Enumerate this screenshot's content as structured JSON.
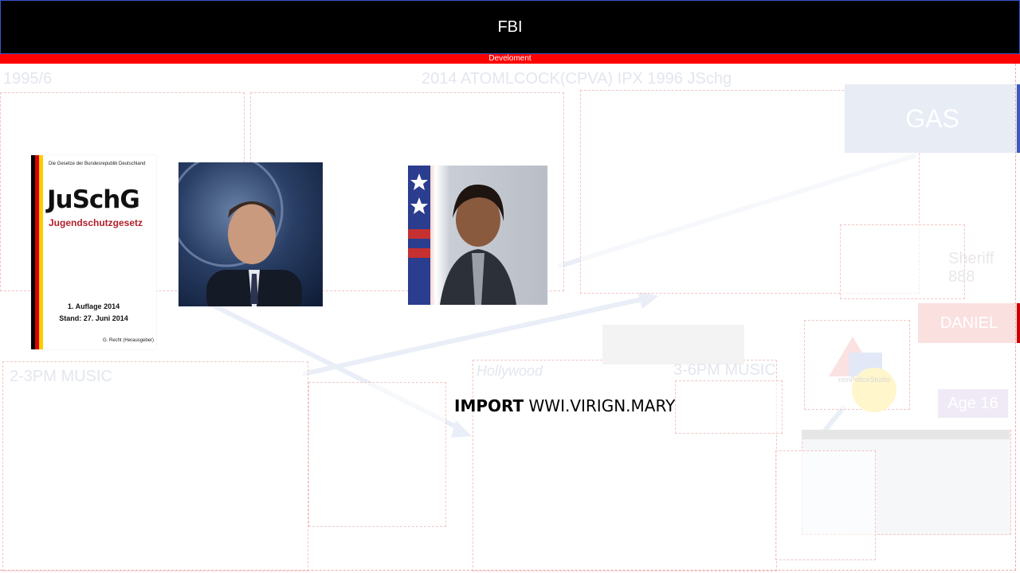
{
  "header": {
    "title": "FBI",
    "subtitle": "Develoment"
  },
  "labels": {
    "top_left": "1995/6",
    "top_center": "2014 ATOMLCOCK(CPVA) IPX 1996 JSchg",
    "music_left": "2-3PM MUSIC",
    "music_right": "3-6PM MUSIC",
    "hollywood": "Hollywood",
    "sheriff": "Sheriff 888",
    "police": "nonPoliceStudio"
  },
  "buttons": {
    "gas": "GAS",
    "daniel": "DANIEL",
    "age": "Age 16"
  },
  "book": {
    "small_header": "Die Gesetze der Bundesrepublik Deutschland",
    "title": "JuSchG",
    "subtitle": "Jugendschutzgesetz",
    "edition": "1. Auflage 2014",
    "date": "Stand: 27. Juni 2014",
    "editor": "G. Recht (Herausgeber)"
  },
  "import_line": {
    "keyword": "IMPORT",
    "value": "WWI.VIRIGN.MARY"
  },
  "colors": {
    "header_bg": "#000000",
    "bar": "#ff0000",
    "gas_edge": "#3a5bbd",
    "daniel_edge": "#cc0000"
  },
  "icons": [
    "person-photo",
    "portrait-photo",
    "arrow"
  ]
}
